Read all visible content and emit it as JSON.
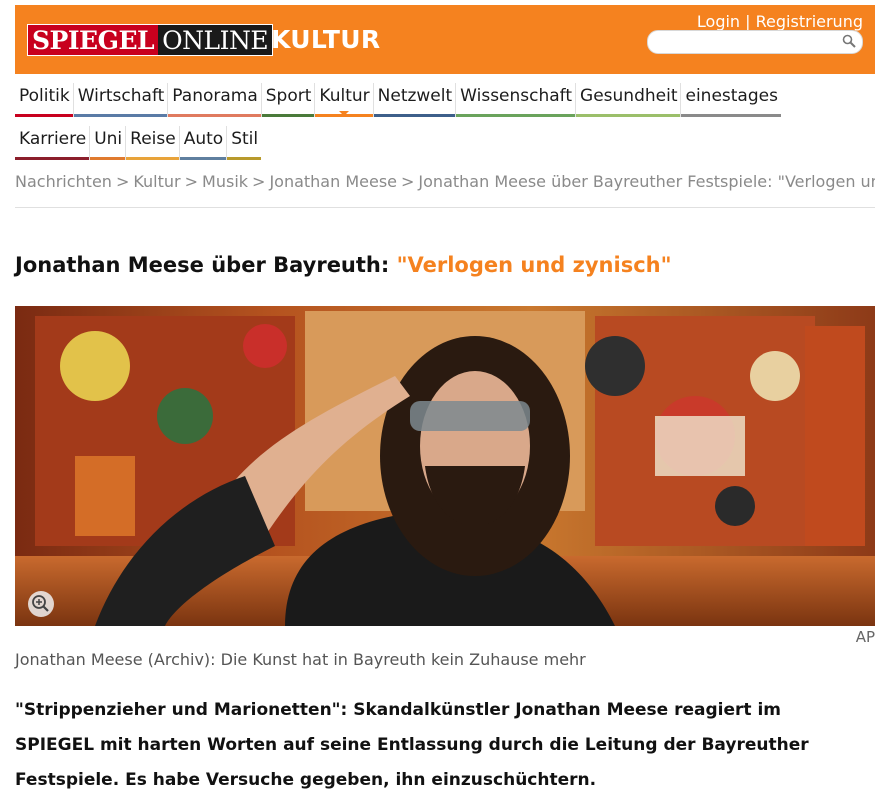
{
  "header": {
    "logo_part1": "SPIEGEL",
    "logo_part2": "ONLINE",
    "section": "KULTUR",
    "login": "Login",
    "separator": "|",
    "register": "Registrierung",
    "search_placeholder": "",
    "accent_color": "#f5821f"
  },
  "nav": {
    "row1": [
      {
        "label": "Politik",
        "color": "#c8001e"
      },
      {
        "label": "Wirtschaft",
        "color": "#5a7ba6"
      },
      {
        "label": "Panorama",
        "color": "#e07a5f"
      },
      {
        "label": "Sport",
        "color": "#4a7a3a"
      },
      {
        "label": "Kultur",
        "color": "#f5821f"
      },
      {
        "label": "Netzwelt",
        "color": "#3d5f8a"
      },
      {
        "label": "Wissenschaft",
        "color": "#6aa35c"
      },
      {
        "label": "Gesundheit",
        "color": "#9bbf6a"
      },
      {
        "label": "einestages",
        "color": "#8a8a8a"
      }
    ],
    "row2": [
      {
        "label": "Karriere",
        "color": "#8b1e2b"
      },
      {
        "label": "Uni",
        "color": "#e07a2f"
      },
      {
        "label": "Reise",
        "color": "#e8a33a"
      },
      {
        "label": "Auto",
        "color": "#5f7f9f"
      },
      {
        "label": "Stil",
        "color": "#b89a2c"
      }
    ],
    "active": "Kultur"
  },
  "breadcrumb": {
    "items": [
      "Nachrichten",
      "Kultur",
      "Musik",
      "Jonathan Meese",
      "Jonathan Meese über Bayreuther Festspiele: \"Verlogen und zynisch\""
    ],
    "separator": ">"
  },
  "article": {
    "headline_prefix": "Jonathan Meese über Bayreuth: ",
    "headline_quote": "\"Verlogen und zynisch\"",
    "image_credit": "AP",
    "caption": "Jonathan Meese (Archiv): Die Kunst hat in Bayreuth kein Zuhause mehr",
    "teaser": "\"Strippenzieher und Marionetten\": Skandalkünstler Jonathan Meese reagiert im SPIEGEL mit harten Worten auf seine Entlassung durch die Leitung der Bayreuther Festspiele. Es habe Versuche gegeben, ihn einzuschüchtern."
  },
  "icons": {
    "search": "magnifier-icon",
    "zoom": "zoom-in-icon"
  }
}
